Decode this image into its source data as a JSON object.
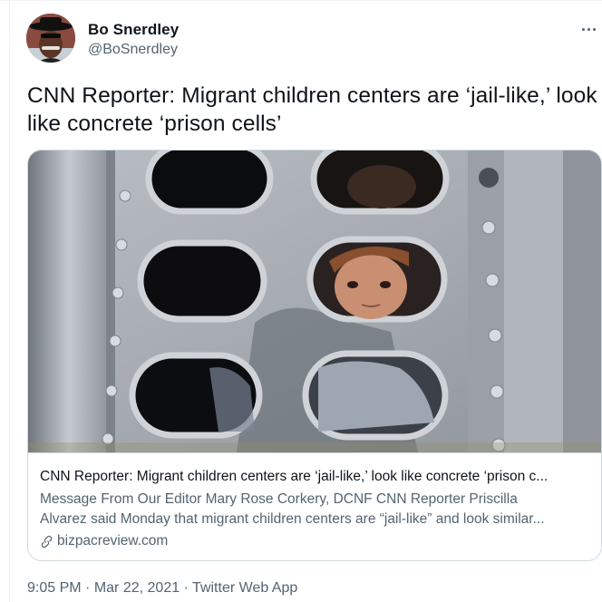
{
  "author": {
    "name": "Bo Snerdley",
    "handle": "@BoSnerdley"
  },
  "tweet": {
    "text": "CNN Reporter: Migrant children centers are ‘jail-like,’ look like concrete ‘prison cells’"
  },
  "card": {
    "title": "CNN Reporter: Migrant children centers are ‘jail-like,’ look like concrete ‘prison c...",
    "description_line1": "Message From Our Editor Mary Rose Corkery, DCNF CNN Reporter Priscilla",
    "description_line2": "Alvarez said Monday that migrant children centers are “jail-like” and look similar...",
    "domain": "bizpacreview.com",
    "image_alt": "child looking through window of metal transport trailer"
  },
  "meta": {
    "time": "9:05 PM",
    "separator": "·",
    "date": "Mar 22, 2021",
    "source": "Twitter Web App"
  },
  "icons": {
    "more": "more-horizontal-icon",
    "link": "link-icon"
  }
}
